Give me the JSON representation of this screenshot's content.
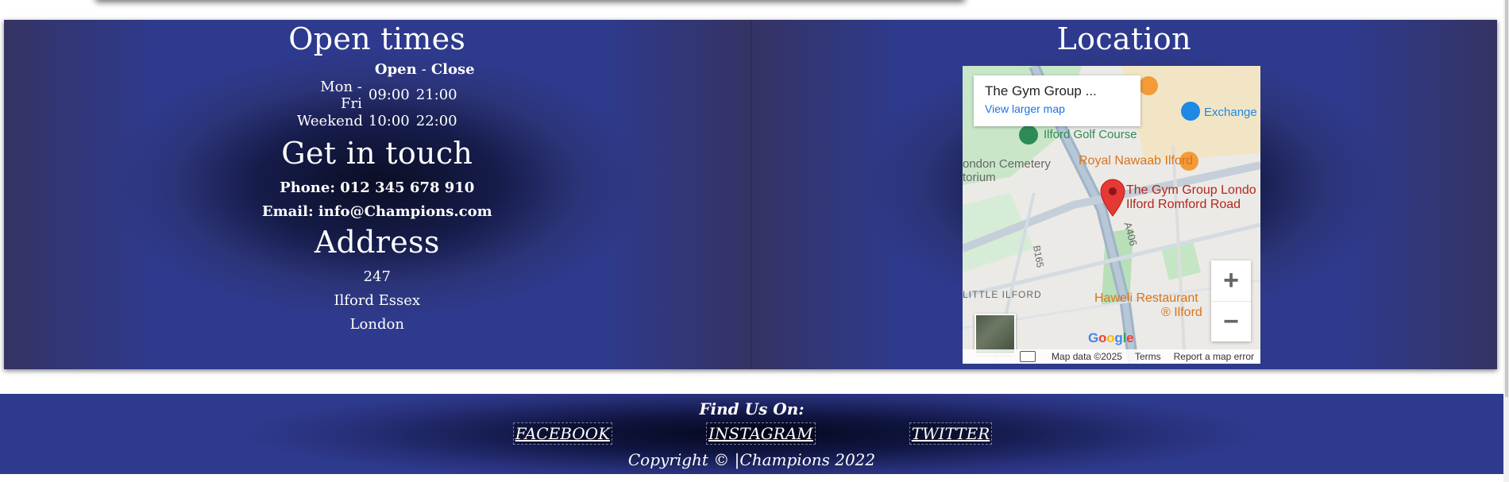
{
  "open_times": {
    "heading": "Open times",
    "header_open": "Open",
    "header_sep": "-",
    "header_close": "Close",
    "rows": [
      {
        "days": "Mon - Fri",
        "open": "09:00",
        "close": "21:00"
      },
      {
        "days": "Weekend",
        "open": "10:00",
        "close": "22:00"
      }
    ]
  },
  "contact": {
    "heading": "Get in touch",
    "phone": "Phone: 012 345 678 910",
    "email": "Email: info@Champions.com"
  },
  "address": {
    "heading": "Address",
    "line1": "247",
    "line2": "Ilford Essex",
    "line3": "London"
  },
  "location": {
    "heading": "Location",
    "map": {
      "place_title": "The Gym Group ...",
      "view_larger": "View larger map",
      "labels": {
        "golf": "Ilford Golf Course",
        "exchange": "Exchange",
        "nawaab": "Royal Nawaab Ilford",
        "cemetery1": "ondon Cemetery",
        "cemetery2": "torium",
        "gym1": "The Gym Group Londo",
        "gym2": "Ilford Romford Road",
        "a406": "A406",
        "b165": "B165",
        "little_ilford": "LITTLE ILFORD",
        "haweli1": "Haweli Restaurant",
        "haweli2": "® Ilford",
        "google": "Google"
      },
      "zoom_in": "+",
      "zoom_out": "−",
      "map_data": "Map data ©2025",
      "terms": "Terms",
      "report": "Report a map error"
    }
  },
  "footer": {
    "find_us": "Find Us On:",
    "links": [
      "FACEBOOK",
      "INSTAGRAM",
      "TWITTER"
    ],
    "copyright": "Copyright © |Champions 2022"
  },
  "colors": {
    "panel_blue": "#2e3a8d",
    "panel_dark": "#0a0e24",
    "link_blue": "#1a73e8",
    "pin_red": "#e53935"
  }
}
